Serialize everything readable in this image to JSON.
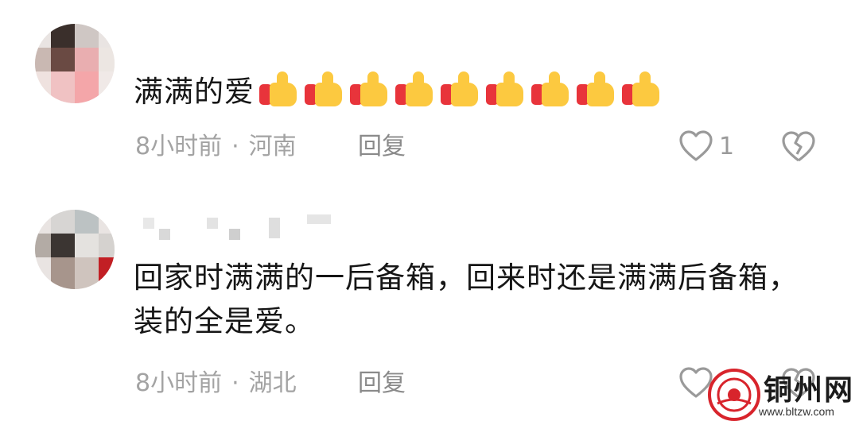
{
  "comments": [
    {
      "text": "满满的爱",
      "emoji": "thumbs-up",
      "emoji_count": 9,
      "time": "8小时前",
      "separator": "·",
      "location": "河南",
      "reply_label": "回复",
      "like_count": "1"
    },
    {
      "text": "回家时满满的一后备箱，回来时还是满满后备箱，装的全是爱。",
      "time": "8小时前",
      "separator": "·",
      "location": "湖北",
      "reply_label": "回复",
      "like_count": ""
    }
  ],
  "watermark": {
    "title": "铜州网",
    "url": "www.bltzw.com"
  },
  "icons": {
    "like": "heart-outline-icon",
    "dislike": "broken-heart-icon"
  },
  "colors": {
    "text": "#161616",
    "meta": "#a3a3a3",
    "icon": "#9a9a9a",
    "watermark_red": "#d8242c"
  }
}
